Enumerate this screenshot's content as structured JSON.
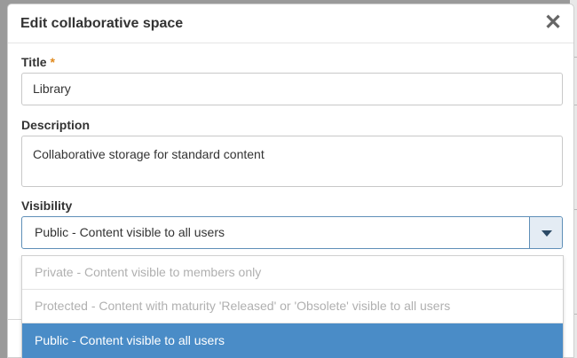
{
  "dialog": {
    "title": "Edit collaborative space",
    "close_glyph": "✕"
  },
  "form": {
    "title_label": "Title",
    "required_marker": "*",
    "title_value": "Library",
    "description_label": "Description",
    "description_value": "Collaborative storage for standard content",
    "visibility_label": "Visibility",
    "visibility_value": "Public - Content visible to all users"
  },
  "visibility_options": [
    {
      "label": "Private - Content visible to members only",
      "selected": false
    },
    {
      "label": "Protected - Content with maturity 'Released' or 'Obsolete' visible to all users",
      "selected": false
    },
    {
      "label": "Public - Content visible to all users",
      "selected": true
    }
  ],
  "colors": {
    "accent": "#4a8cc7",
    "required": "#e08a1e",
    "disabled_text": "#b0b0b0"
  },
  "icons": {
    "close": "close-icon",
    "dropdown": "chevron-down-icon"
  }
}
